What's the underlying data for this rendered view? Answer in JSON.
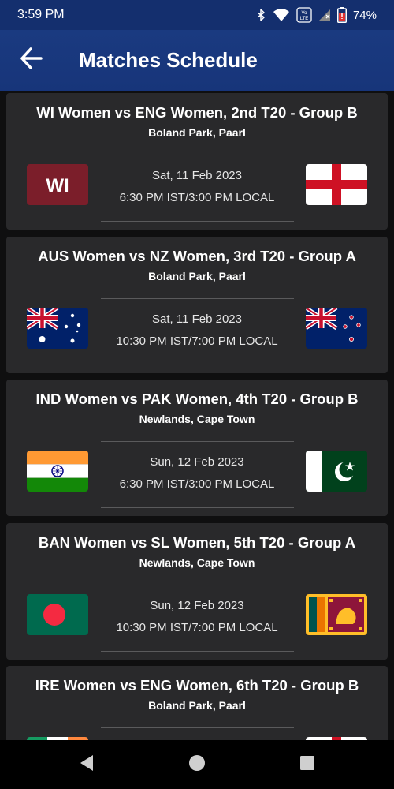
{
  "status_bar": {
    "time": "3:59 PM",
    "battery": "74%",
    "volte_label": "Vo LTE"
  },
  "app_bar": {
    "title": "Matches Schedule"
  },
  "matches": [
    {
      "title": "WI Women vs ENG Women, 2nd T20 - Group B",
      "venue": "Boland Park, Paarl",
      "date": "Sat, 11 Feb 2023",
      "time": "6:30 PM IST/3:00 PM LOCAL",
      "team1_flag": "west-indies-flag",
      "team1_text": "WI",
      "team2_flag": "england-flag"
    },
    {
      "title": "AUS Women vs NZ Women, 3rd T20 - Group A",
      "venue": "Boland Park, Paarl",
      "date": "Sat, 11 Feb 2023",
      "time": "10:30 PM IST/7:00 PM LOCAL",
      "team1_flag": "australia-flag",
      "team2_flag": "new-zealand-flag"
    },
    {
      "title": "IND Women vs PAK Women, 4th T20 - Group B",
      "venue": "Newlands, Cape Town",
      "date": "Sun, 12 Feb 2023",
      "time": "6:30 PM IST/3:00 PM LOCAL",
      "team1_flag": "india-flag",
      "team2_flag": "pakistan-flag"
    },
    {
      "title": "BAN Women vs SL Women, 5th T20 - Group A",
      "venue": "Newlands, Cape Town",
      "date": "Sun, 12 Feb 2023",
      "time": "10:30 PM IST/7:00 PM LOCAL",
      "team1_flag": "bangladesh-flag",
      "team2_flag": "sri-lanka-flag"
    },
    {
      "title": "IRE Women vs ENG Women, 6th T20 - Group B",
      "venue": "Boland Park, Paarl",
      "date": "",
      "time": "",
      "team1_flag": "ireland-flag",
      "team2_flag": "england-flag"
    }
  ],
  "colors": {
    "status_bar": "#142f6e",
    "app_bar": "#1a3a80",
    "card": "#29292b",
    "background": "#0f0f10"
  },
  "nav": {
    "back_icon": "triangle-back-icon",
    "home_icon": "circle-home-icon",
    "recents_icon": "square-recents-icon"
  }
}
